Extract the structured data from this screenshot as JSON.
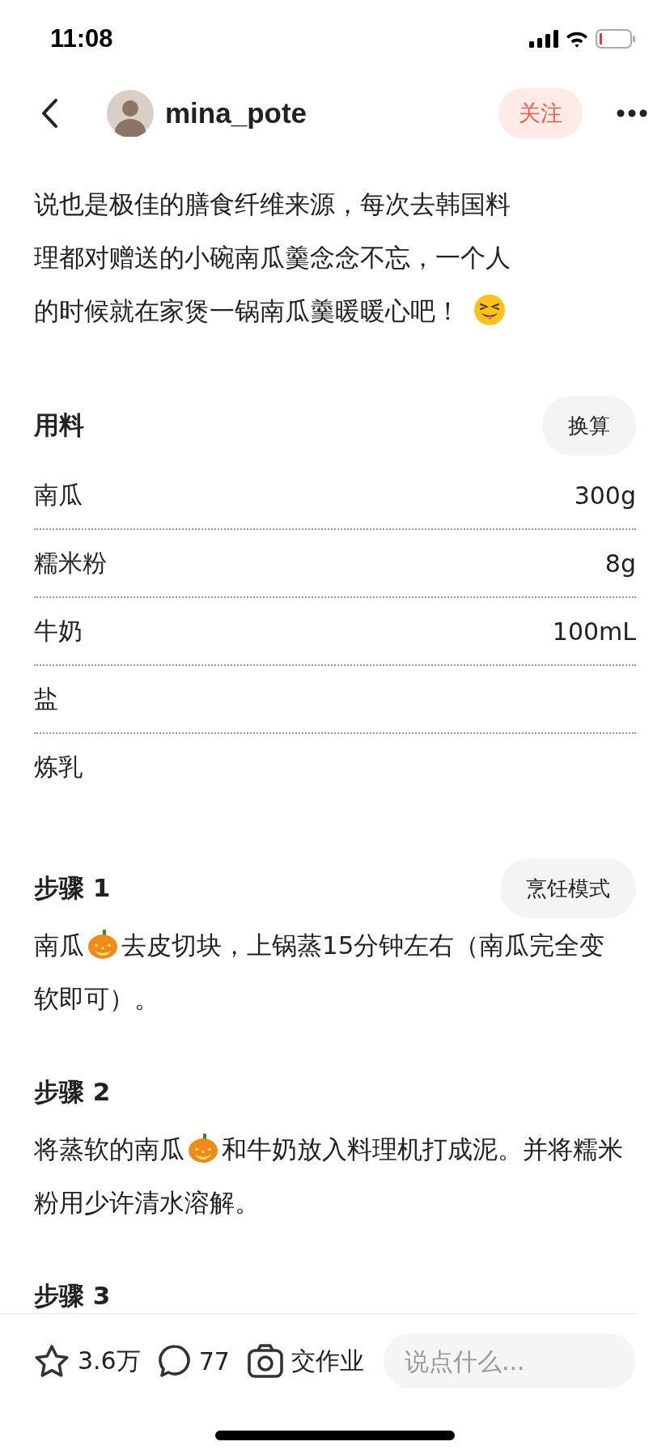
{
  "status_bar": {
    "time": "11:08"
  },
  "header": {
    "username": "mina_pote",
    "follow_label": "关注"
  },
  "intro": {
    "lines": [
      "说也是极佳的膳食纤维来源，每次去韩国料",
      "理都对赠送的小碗南瓜羹念念不忘，一个人",
      "的时候就在家煲一锅南瓜羹暖暖心吧！"
    ]
  },
  "ingredients": {
    "title": "用料",
    "convert_label": "换算",
    "items": [
      {
        "name": "南瓜",
        "amount": "300g"
      },
      {
        "name": "糯米粉",
        "amount": "8g"
      },
      {
        "name": "牛奶",
        "amount": "100mL"
      },
      {
        "name": "盐"
      },
      {
        "name": "炼乳"
      }
    ]
  },
  "steps": {
    "cooking_mode_label": "烹饪模式",
    "items": [
      {
        "title": "步骤 1",
        "parts": [
          "南瓜",
          "去皮切块，上锅蒸15分钟左右（南瓜完全变软即可）。"
        ]
      },
      {
        "title": "步骤 2",
        "parts": [
          "将蒸软的南瓜",
          "和牛奶放入料理机打成泥。并将糯米粉用少许清水溶解。"
        ]
      },
      {
        "title": "步骤 3"
      }
    ]
  },
  "bottom_bar": {
    "favorites": "3.6万",
    "comments": "77",
    "homework_label": "交作业",
    "comment_placeholder": "说点什么..."
  }
}
